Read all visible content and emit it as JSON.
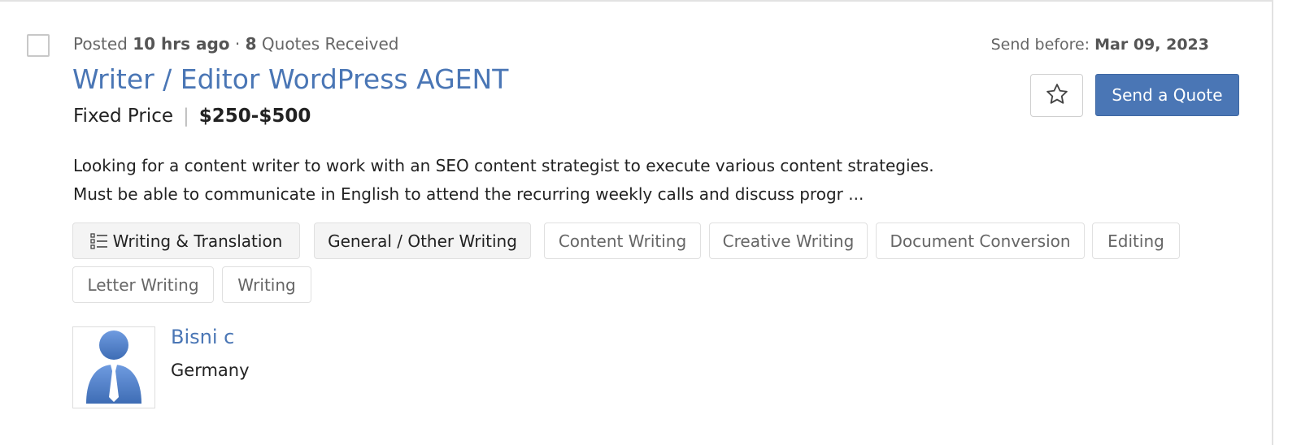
{
  "job": {
    "meta": {
      "posted_prefix": "Posted",
      "posted_ago": "10 hrs ago",
      "dot": "·",
      "quotes_count": "8",
      "quotes_label": "Quotes Received"
    },
    "title": "Writer / Editor WordPress AGENT",
    "price_type": "Fixed Price",
    "price_separator": "|",
    "price_range": "$250-$500",
    "send_before_label": "Send before:",
    "send_before_date": "Mar 09, 2023",
    "favorite_icon": "star-icon",
    "send_quote_label": "Send a Quote",
    "description_lines": [
      "Looking for a content writer to work with an SEO content strategist to execute various content strategies.",
      "Must be able to communicate in English to attend the recurring weekly calls and discuss progr ..."
    ],
    "tags": [
      "Writing & Translation",
      "General / Other Writing",
      "Content Writing",
      "Creative Writing",
      "Document Conversion",
      "Editing",
      "Letter Writing",
      "Writing"
    ]
  },
  "client": {
    "name": "Bisni c",
    "country": "Germany"
  },
  "colors": {
    "accent": "#4a76b5",
    "tag_primary_bg": "#f4f4f4",
    "border": "#e0e0e0"
  }
}
